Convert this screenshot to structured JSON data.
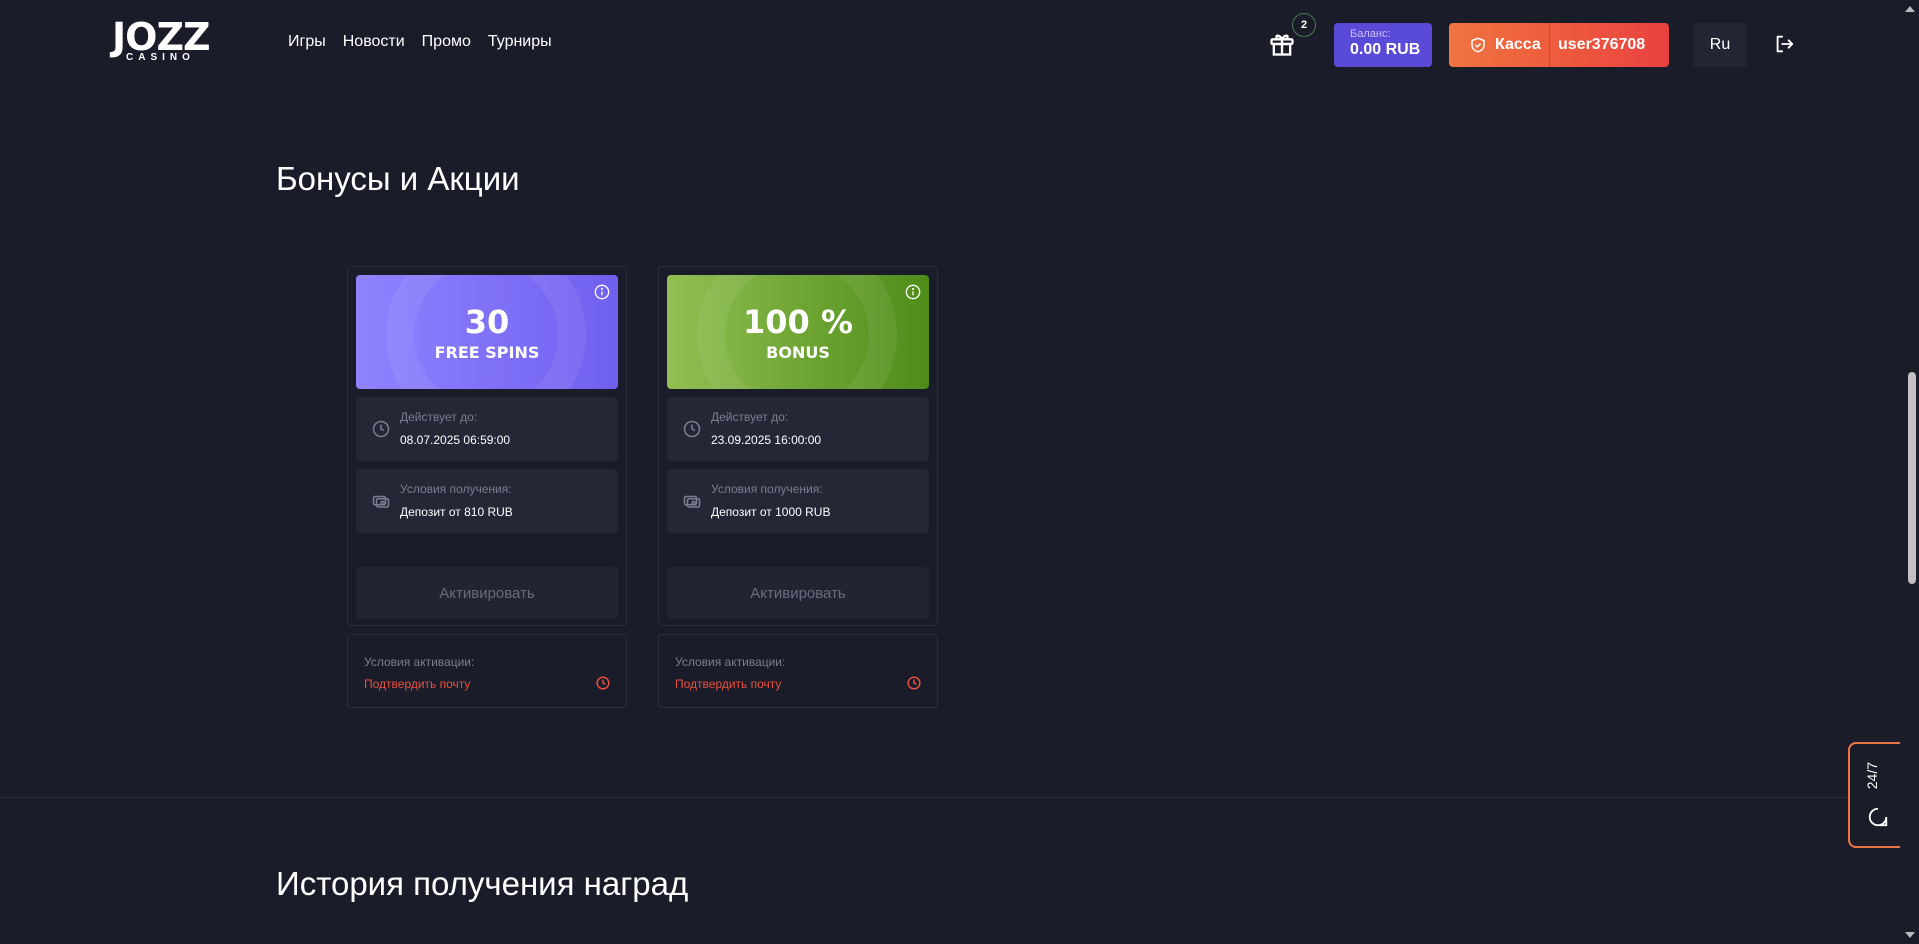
{
  "header": {
    "logo": {
      "main": "JOZZ",
      "sub": "CASINO"
    },
    "nav": [
      "Игры",
      "Новости",
      "Промо",
      "Турниры"
    ],
    "gift_badge": "2",
    "balance": {
      "label": "Баланс:",
      "value": "0.00 RUB"
    },
    "kassa_label": "Касса",
    "username": "user376708",
    "language": "Ru"
  },
  "bonuses": {
    "title": "Бонусы и Акции",
    "cards": [
      {
        "big": "30",
        "small": "FREE SPINS",
        "valid_label": "Действует до:",
        "valid_value": "08.07.2025 06:59:00",
        "terms_label": "Условия получения:",
        "terms_value": "Депозит от 810 RUB",
        "activate_label": "Активировать",
        "cond_label": "Условия активации:",
        "cond_link": "Подтвердить почту"
      },
      {
        "big": "100 %",
        "small": "BONUS",
        "valid_label": "Действует до:",
        "valid_value": "23.09.2025 16:00:00",
        "terms_label": "Условия получения:",
        "terms_value": "Депозит от 1000 RUB",
        "activate_label": "Активировать",
        "cond_label": "Условия активации:",
        "cond_link": "Подтвердить почту"
      }
    ]
  },
  "history": {
    "title": "История получения наград"
  },
  "support": {
    "label": "24/7"
  },
  "colors": {
    "accent_orange": "#ee7445",
    "balance_purple": "#5a4ad8",
    "link_red": "#e8503e"
  }
}
